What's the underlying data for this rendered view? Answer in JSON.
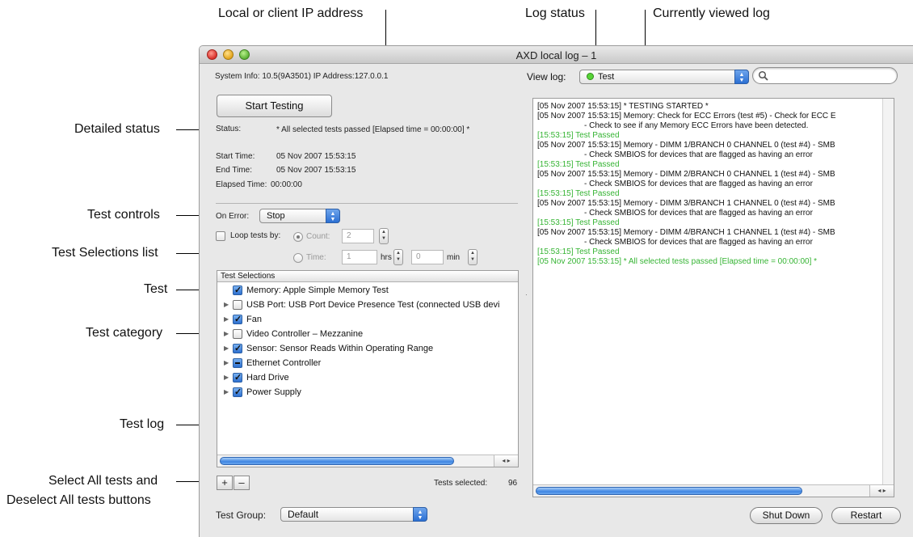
{
  "callouts": {
    "local_ip": "Local or client IP address",
    "log_status": "Log status",
    "current_log": "Currently viewed log",
    "detailed_status": "Detailed status",
    "test_controls": "Test controls",
    "test_selections_list": "Test Selections list",
    "test": "Test",
    "test_category": "Test category",
    "test_log": "Test log",
    "select_all_line1": "Select All tests and",
    "select_all_line2": "Deselect All tests buttons"
  },
  "window": {
    "title": "AXD local log – 1"
  },
  "toolbar": {
    "system_info": "System Info: 10.5(9A3501)  IP Address:127.0.0.1",
    "view_log_label": "View log:",
    "view_log_value": "Test",
    "log_status_color": "#58d438"
  },
  "controls": {
    "start_button": "Start Testing",
    "status_label": "Status:",
    "status_value": "* All selected tests passed [Elapsed time = 00:00:00] *",
    "start_time_label": "Start Time:",
    "start_time_value": "05 Nov 2007 15:53:15",
    "end_time_label": "End Time:",
    "end_time_value": "05 Nov 2007 15:53:15",
    "elapsed_label": "Elapsed Time:",
    "elapsed_value": "00:00:00",
    "on_error_label": "On Error:",
    "on_error_value": "Stop",
    "loop_label": "Loop tests by:",
    "count_label": "Count:",
    "count_value": "2",
    "time_label": "Time:",
    "time_hrs_value": "1",
    "hrs_label": "hrs",
    "time_min_value": "0",
    "min_label": "min"
  },
  "selections": {
    "header": "Test Selections",
    "items": [
      {
        "label": "Memory: Apple Simple Memory Test",
        "state": "checked",
        "disclosure": false
      },
      {
        "label": "USB Port: USB Port Device Presence Test (connected USB devi",
        "state": "unchecked",
        "disclosure": true
      },
      {
        "label": "Fan",
        "state": "checked",
        "disclosure": true
      },
      {
        "label": "Video Controller – Mezzanine",
        "state": "unchecked",
        "disclosure": true
      },
      {
        "label": "Sensor: Sensor Reads Within Operating Range",
        "state": "checked",
        "disclosure": true
      },
      {
        "label": "Ethernet Controller",
        "state": "mixed",
        "disclosure": true
      },
      {
        "label": "Hard Drive",
        "state": "checked",
        "disclosure": true
      },
      {
        "label": "Power Supply",
        "state": "checked",
        "disclosure": true
      }
    ],
    "add_label": "+",
    "remove_label": "–",
    "tests_selected_label": "Tests selected:",
    "tests_selected_value": "96"
  },
  "footer": {
    "test_group_label": "Test Group:",
    "test_group_value": "Default",
    "shutdown_button": "Shut Down",
    "restart_button": "Restart"
  },
  "log": {
    "lines": [
      {
        "text": "[05 Nov 2007 15:53:15] * TESTING STARTED *",
        "style": "normal"
      },
      {
        "text": "[05 Nov 2007 15:53:15]    Memory: Check for ECC Errors (test #5) - Check for ECC E",
        "style": "normal"
      },
      {
        "text": "- Check to see if any Memory ECC Errors have been detected.",
        "style": "indent"
      },
      {
        "text": "[15:53:15]        Test Passed",
        "style": "green"
      },
      {
        "text": "[05 Nov 2007 15:53:15]    Memory - DIMM 1/BRANCH 0 CHANNEL 0 (test #4) - SMB",
        "style": "normal"
      },
      {
        "text": "- Check SMBIOS for devices that are flagged as having an error",
        "style": "indent"
      },
      {
        "text": "[15:53:15]        Test Passed",
        "style": "green"
      },
      {
        "text": "[05 Nov 2007 15:53:15]    Memory - DIMM 2/BRANCH 0 CHANNEL 1 (test #4) - SMB",
        "style": "normal"
      },
      {
        "text": "- Check SMBIOS for devices that are flagged as having an error",
        "style": "indent"
      },
      {
        "text": "[15:53:15]        Test Passed",
        "style": "green"
      },
      {
        "text": "[05 Nov 2007 15:53:15]    Memory - DIMM 3/BRANCH 1 CHANNEL 0 (test #4) - SMB",
        "style": "normal"
      },
      {
        "text": "- Check SMBIOS for devices that are flagged as having an error",
        "style": "indent"
      },
      {
        "text": "[15:53:15]        Test Passed",
        "style": "green"
      },
      {
        "text": "[05 Nov 2007 15:53:15]    Memory - DIMM 4/BRANCH 1 CHANNEL 1 (test #4) - SMB",
        "style": "normal"
      },
      {
        "text": "- Check SMBIOS for devices that are flagged as having an error",
        "style": "indent"
      },
      {
        "text": "[15:53:15]        Test Passed",
        "style": "green"
      },
      {
        "text": "[05 Nov 2007 15:53:15] * All selected tests passed [Elapsed time = 00:00:00] *",
        "style": "green"
      }
    ]
  }
}
